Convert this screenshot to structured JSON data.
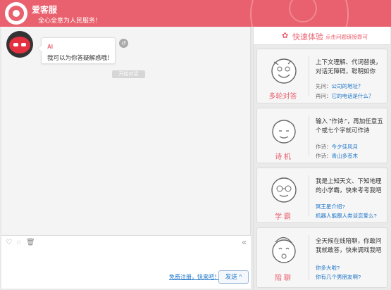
{
  "header": {
    "app_title": "爱客服",
    "subtitle": "全心全意为人民服务！"
  },
  "chat": {
    "messages": [
      {
        "sender": "AI",
        "text": "我可以为你答疑解惑哦！"
      }
    ],
    "start_chip": "开始对话"
  },
  "composer": {
    "register_link": "免费注册，快来吧！",
    "send_label": "发送",
    "send_caret": "^",
    "collapse_glyph": "«"
  },
  "sidebar": {
    "title": "快速体验",
    "subtitle": "点击问题链接即可",
    "cards": [
      {
        "label": "多轮对答",
        "description": "上下文理解、代词替换，对话无障碍，聪明如你",
        "samples": [
          {
            "prefix": "先问：",
            "link": "公司的地址？"
          },
          {
            "prefix": "再问：",
            "link": "它的电话是什么？"
          }
        ]
      },
      {
        "label": "诗 机",
        "description": "输入 \"作诗:\"，再加任意五个或七个字就可作诗",
        "samples": [
          {
            "prefix": "作诗：",
            "link": "今夕佳风月"
          },
          {
            "prefix": "作诗：",
            "link": "青山多苍木"
          }
        ]
      },
      {
        "label": "学 霸",
        "description": "我是上知天文、下知地理的小学霸，快来考考我吧",
        "samples": [
          {
            "prefix": "",
            "link": "冥王星介绍?"
          },
          {
            "prefix": "",
            "link": "机器人能跟人类谈恋爱么?"
          }
        ]
      },
      {
        "label": "陪 聊",
        "description": "全天候在线陪聊，你敢问我就敢答，快来调戏我吧",
        "samples": [
          {
            "prefix": "",
            "link": "你多大啦?"
          },
          {
            "prefix": "",
            "link": "你有几个男朋友啊?"
          }
        ]
      }
    ]
  },
  "icons": {
    "tool_emoji": "emoji-icon",
    "tool_chat": "chat-bubble-icon",
    "tool_delete": "trash-icon"
  },
  "colors": {
    "brand": "#e9606e",
    "link": "#1a73c8"
  }
}
